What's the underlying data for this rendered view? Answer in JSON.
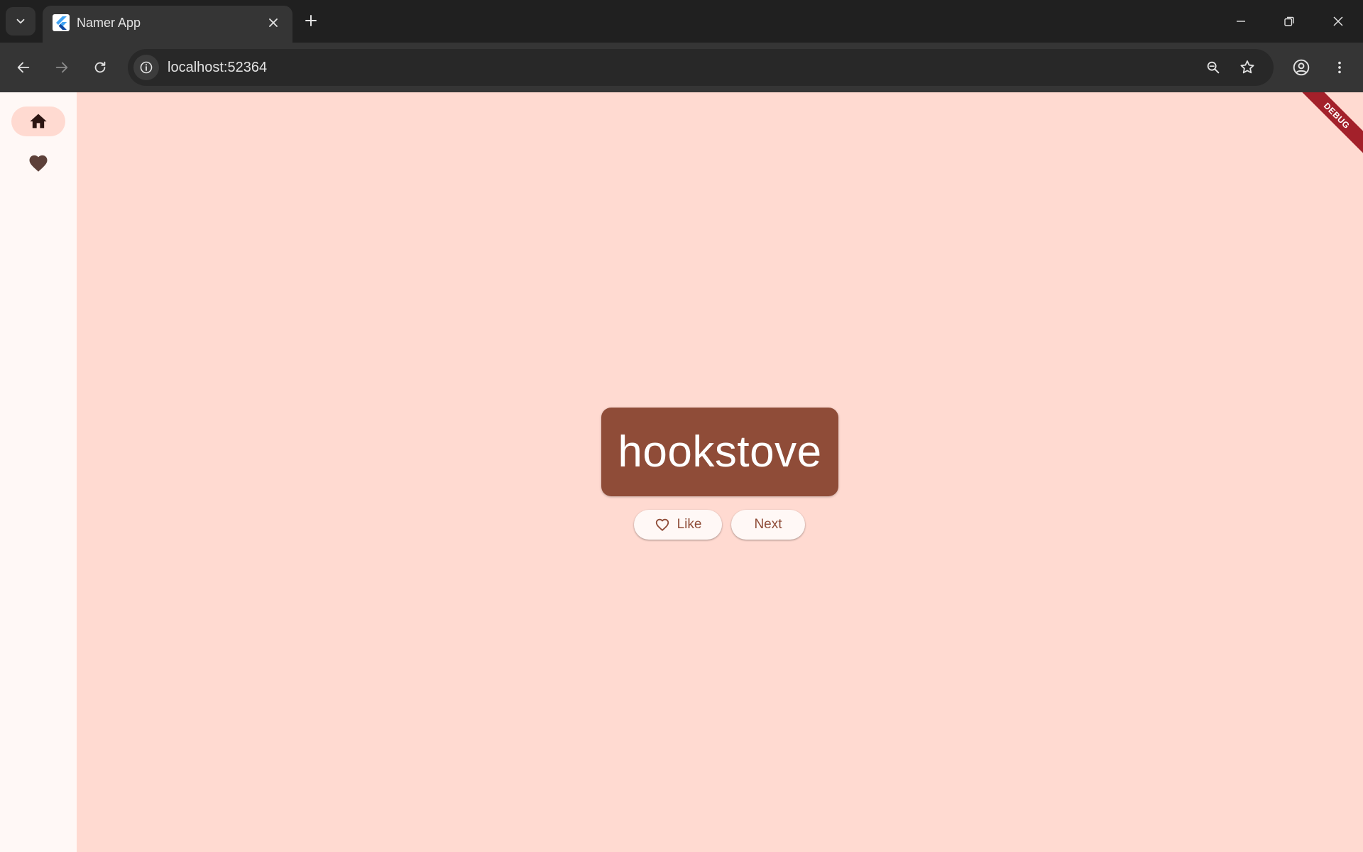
{
  "browser": {
    "tab": {
      "title": "Namer App",
      "favicon": "flutter-logo-icon",
      "close_icon": "close-icon"
    },
    "tab_search_icon": "chevron-down-icon",
    "new_tab_icon": "plus-icon",
    "window_controls": [
      "minimize-icon",
      "restore-icon",
      "close-icon"
    ],
    "toolbar": {
      "back_icon": "arrow-left-icon",
      "forward_icon": "arrow-right-icon",
      "reload_icon": "reload-icon",
      "site_info_icon": "info-icon",
      "url": "localhost:52364",
      "zoom_icon": "zoom-out-icon",
      "bookmark_icon": "star-icon",
      "profile_icon": "account-circle-icon",
      "menu_icon": "more-vert-icon"
    }
  },
  "app": {
    "nav_rail": {
      "items": [
        {
          "icon": "home-icon",
          "selected": true
        },
        {
          "icon": "favorite-icon",
          "selected": false
        }
      ]
    },
    "current_word": "hookstove",
    "buttons": {
      "like_label": "Like",
      "like_icon": "heart-outline-icon",
      "next_label": "Next"
    },
    "debug_banner": "DEBUG"
  },
  "colors": {
    "background": "#ffdad1",
    "nav_rail": "#fff8f6",
    "card": "#8f4c38",
    "card_text": "#ffffff",
    "button_text": "#8f4c38",
    "rail_selected": "#ffdad1",
    "debug_banner": "#a3202a",
    "browser_frame": "#202020",
    "toolbar": "#353535"
  }
}
